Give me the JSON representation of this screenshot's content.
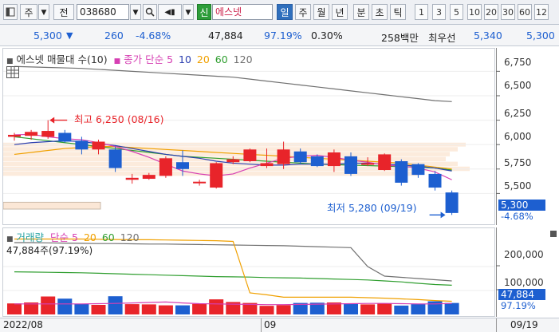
{
  "toolbar": {
    "market": "주",
    "type": "전",
    "code": "038680",
    "stock_badge": "신",
    "stock_name": "에스넷",
    "periods": [
      "일",
      "주",
      "월",
      "년",
      "분",
      "초",
      "틱"
    ],
    "active_period": "일",
    "intervals": [
      "1",
      "3",
      "5",
      "10",
      "20",
      "30",
      "60",
      "12"
    ]
  },
  "quote": {
    "price": "5,300",
    "direction": "▼",
    "change": "260",
    "change_pct": "-4.68%",
    "volume": "47,884",
    "volume_ratio": "97.19%",
    "turnover_pct": "0.30%",
    "amount": "258백만",
    "best_ask_label": "최우선",
    "best_ask": "5,340",
    "best_bid": "5,300"
  },
  "price_panel": {
    "legend_title": "에스넷 매물대 수(10)",
    "ma_label": "종가 단순",
    "ma_periods": [
      "5",
      "10",
      "20",
      "60",
      "120"
    ],
    "high_annotation": "최고 6,250 (08/16)",
    "low_annotation": "최저 5,280 (09/19)",
    "last_price": "5,300",
    "last_change": "-4.68%",
    "y_ticks": [
      "6,750",
      "6,500",
      "6,250",
      "6,000",
      "5,750",
      "5,500"
    ]
  },
  "volume_panel": {
    "legend_title": "거래량",
    "ma_label": "단순",
    "ma_periods": [
      "5",
      "20",
      "60",
      "120"
    ],
    "info_text": "47,884주(97.19%)",
    "last_volume": "47,884",
    "last_ratio": "97.19%",
    "y_ticks": [
      "200,000",
      "100,000"
    ]
  },
  "x_axis": {
    "left_label": "2022/08",
    "mid_label": "09",
    "right_label": "09/19"
  },
  "colors": {
    "up": "#e8242a",
    "down": "#1d5fd0",
    "ma5": "#d63fb3",
    "ma10": "#2b3fb0",
    "ma20": "#f0a000",
    "ma60": "#2f9e2f",
    "ma120": "#707070"
  },
  "chart_data": [
    {
      "type": "candlestick",
      "title": "에스넷 매물대 수(10)",
      "candles": [
        {
          "o": 6080,
          "h": 6120,
          "l": 6040,
          "c": 6100
        },
        {
          "o": 6090,
          "h": 6150,
          "l": 6050,
          "c": 6130
        },
        {
          "o": 6080,
          "h": 6250,
          "l": 6060,
          "c": 6140
        },
        {
          "o": 6120,
          "h": 6150,
          "l": 6020,
          "c": 6030
        },
        {
          "o": 6040,
          "h": 6080,
          "l": 5900,
          "c": 5950
        },
        {
          "o": 5950,
          "h": 6050,
          "l": 5900,
          "c": 6030
        },
        {
          "o": 5950,
          "h": 5980,
          "l": 5720,
          "c": 5760
        },
        {
          "o": 5640,
          "h": 5700,
          "l": 5600,
          "c": 5660
        },
        {
          "o": 5650,
          "h": 5710,
          "l": 5640,
          "c": 5690
        },
        {
          "o": 5680,
          "h": 5880,
          "l": 5660,
          "c": 5860
        },
        {
          "o": 5820,
          "h": 5940,
          "l": 5680,
          "c": 5750
        },
        {
          "o": 5610,
          "h": 5640,
          "l": 5580,
          "c": 5620
        },
        {
          "o": 5560,
          "h": 5820,
          "l": 5550,
          "c": 5810
        },
        {
          "o": 5820,
          "h": 5880,
          "l": 5800,
          "c": 5850
        },
        {
          "o": 5830,
          "h": 5960,
          "l": 5820,
          "c": 5950
        },
        {
          "o": 5780,
          "h": 5960,
          "l": 5760,
          "c": 5810
        },
        {
          "o": 5800,
          "h": 6030,
          "l": 5750,
          "c": 5950
        },
        {
          "o": 5930,
          "h": 5960,
          "l": 5800,
          "c": 5820
        },
        {
          "o": 5880,
          "h": 5900,
          "l": 5770,
          "c": 5780
        },
        {
          "o": 5780,
          "h": 5950,
          "l": 5720,
          "c": 5920
        },
        {
          "o": 5880,
          "h": 5920,
          "l": 5680,
          "c": 5700
        },
        {
          "o": 5800,
          "h": 5870,
          "l": 5780,
          "c": 5810
        },
        {
          "o": 5740,
          "h": 5910,
          "l": 5730,
          "c": 5900
        },
        {
          "o": 5830,
          "h": 5850,
          "l": 5580,
          "c": 5610
        },
        {
          "o": 5800,
          "h": 5810,
          "l": 5660,
          "c": 5690
        },
        {
          "o": 5700,
          "h": 5730,
          "l": 5530,
          "c": 5560
        },
        {
          "o": 5510,
          "h": 5530,
          "l": 5280,
          "c": 5300
        }
      ],
      "ma5": [
        6100,
        6105,
        6080,
        6060,
        6050,
        6020,
        5980,
        5930,
        5870,
        5800,
        5730,
        5700,
        5680,
        5700,
        5760,
        5810,
        5860,
        5880,
        5890,
        5870,
        5840,
        5820,
        5790,
        5780,
        5760,
        5720,
        5640
      ],
      "ma10": [
        6000,
        6020,
        6030,
        6040,
        6030,
        6010,
        5990,
        5960,
        5930,
        5900,
        5880,
        5860,
        5830,
        5810,
        5800,
        5790,
        5790,
        5800,
        5800,
        5800,
        5810,
        5810,
        5800,
        5790,
        5780,
        5760,
        5730
      ],
      "ma20": [
        5900,
        5920,
        5940,
        5960,
        5970,
        5980,
        5980,
        5970,
        5960,
        5950,
        5940,
        5930,
        5920,
        5910,
        5900,
        5890,
        5880,
        5870,
        5860,
        5850,
        5840,
        5830,
        5820,
        5810,
        5790,
        5770,
        5750
      ],
      "ma60": [
        6080,
        6060,
        6040,
        6020,
        6000,
        5980,
        5960,
        5940,
        5920,
        5900,
        5880,
        5870,
        5860,
        5850,
        5840,
        5830,
        5820,
        5810,
        5800,
        5795,
        5790,
        5785,
        5780,
        5775,
        5770,
        5760,
        5740
      ],
      "ma120": [
        6800,
        6795,
        6790,
        6785,
        6780,
        6770,
        6760,
        6750,
        6740,
        6730,
        6720,
        6710,
        6700,
        6690,
        6670,
        6650,
        6630,
        6610,
        6590,
        6570,
        6550,
        6530,
        6510,
        6490,
        6470,
        6450,
        6440
      ],
      "ylim": [
        5250,
        6900
      ],
      "y_ticks": [
        6750,
        6500,
        6250,
        6000,
        5750,
        5500
      ]
    },
    {
      "type": "bar",
      "title": "거래량",
      "values": [
        46000,
        50000,
        75000,
        66000,
        45000,
        40000,
        76000,
        43000,
        42000,
        38000,
        38000,
        44000,
        63000,
        52000,
        48000,
        36000,
        39000,
        48000,
        49000,
        50000,
        44000,
        42000,
        47000,
        37000,
        43000,
        55000,
        47884
      ],
      "ma5": [
        44000,
        44000,
        44000,
        44000,
        44000,
        45000,
        46000,
        48000,
        50000,
        52000,
        48000,
        45000,
        44000,
        43000,
        42000,
        41000,
        41000,
        42000,
        43000,
        44000,
        45000,
        46000,
        46000,
        45000,
        44000,
        44000,
        46000
      ],
      "ma20": [
        315000,
        315000,
        315000,
        315000,
        315000,
        314000,
        313000,
        312000,
        312000,
        311000,
        310000,
        309000,
        308000,
        305000,
        90000,
        82000,
        72000,
        72000,
        72000,
        72000,
        72000,
        70000,
        68000,
        65000,
        62000,
        58000,
        55000
      ],
      "ma60": [
        178000,
        177000,
        176000,
        175000,
        174000,
        172000,
        170000,
        168000,
        166000,
        164000,
        162000,
        160000,
        158000,
        157000,
        156000,
        154000,
        153000,
        152000,
        150000,
        148000,
        146000,
        144000,
        140000,
        136000,
        130000,
        125000,
        122000
      ],
      "ma120": [
        300000,
        300000,
        299000,
        298000,
        297000,
        296000,
        296000,
        295000,
        294000,
        294000,
        293000,
        292000,
        291000,
        290000,
        289000,
        288000,
        287000,
        285000,
        283000,
        281000,
        279000,
        200000,
        160000,
        155000,
        150000,
        145000,
        140000
      ],
      "ylim": [
        0,
        340000
      ],
      "y_ticks": [
        200000,
        100000
      ]
    }
  ]
}
